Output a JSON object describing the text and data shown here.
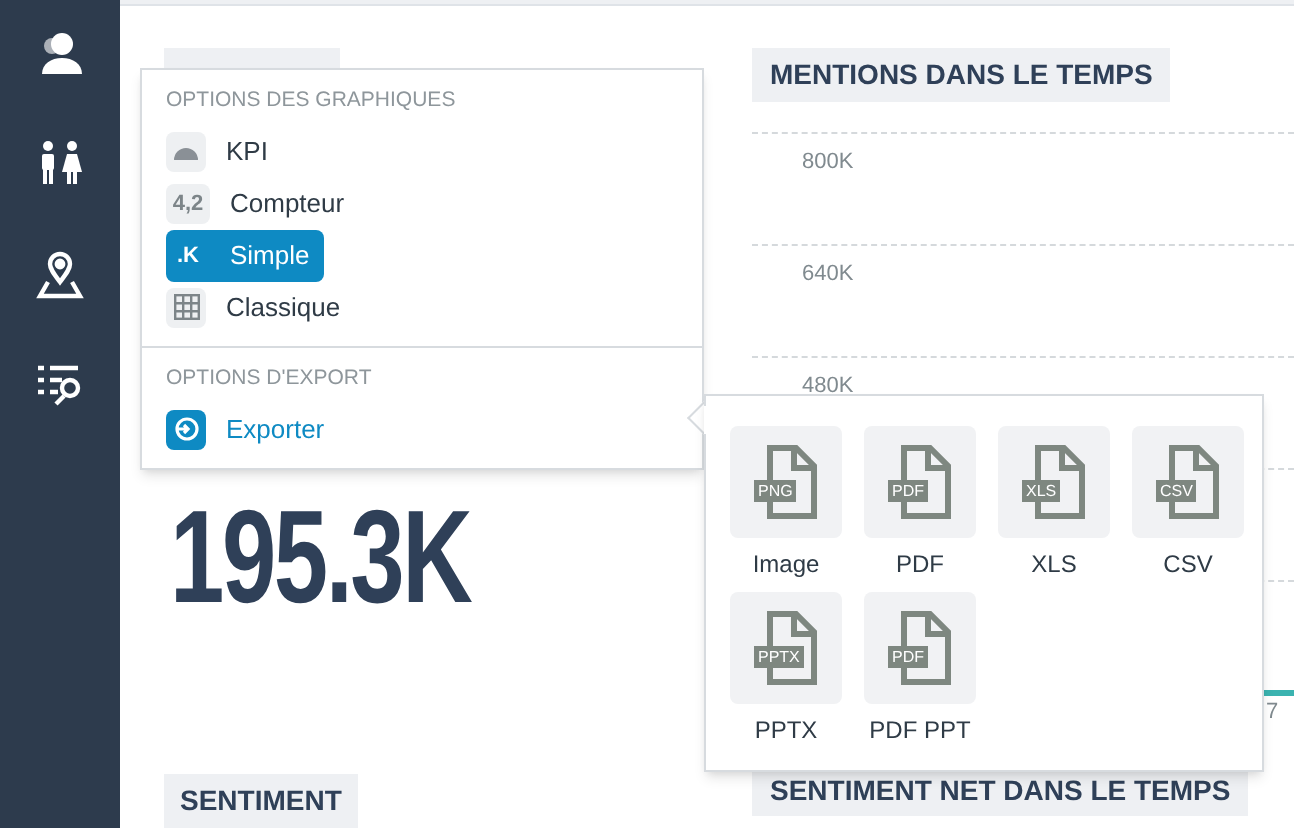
{
  "cards": [
    {
      "title": "SENTIMENT"
    }
  ],
  "mentions_card": {
    "value": "195.3K"
  },
  "chart": {
    "title": "MENTIONS DANS LE TEMPS",
    "tick_labels": [
      "800K",
      "640K",
      "480K"
    ],
    "x_tick": "7"
  },
  "bottom_chart": {
    "title": "SENTIMENT NET DANS LE TEMPS"
  },
  "menu": {
    "sections": [
      {
        "title": "OPTIONS DES GRAPHIQUES",
        "items": [
          {
            "kind": "gauge",
            "label": "KPI",
            "selected": false
          },
          {
            "kind": "text",
            "icon_text": "4,2",
            "label": "Compteur",
            "selected": false
          },
          {
            "kind": "text",
            "icon_text": ".K",
            "label": "Simple",
            "selected": true
          },
          {
            "kind": "grid",
            "label": "Classique",
            "selected": false
          }
        ]
      },
      {
        "title": "OPTIONS D'EXPORT",
        "items": [
          {
            "kind": "export",
            "label": "Exporter",
            "selected": false
          }
        ]
      }
    ]
  },
  "export_formats": [
    {
      "badge": "PNG",
      "label": "Image"
    },
    {
      "badge": "PDF",
      "label": "PDF"
    },
    {
      "badge": "XLS",
      "label": "XLS"
    },
    {
      "badge": "CSV",
      "label": "CSV"
    },
    {
      "badge": "PPTX",
      "label": "PPTX"
    },
    {
      "badge": "PDF",
      "label": "PDF PPT"
    }
  ]
}
